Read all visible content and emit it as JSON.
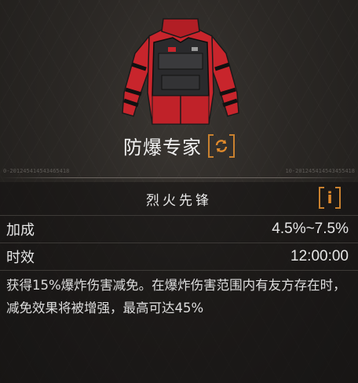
{
  "item": {
    "name": "防爆专家",
    "image_icon": "red-black-armored-jacket",
    "switch_icon": "refresh-cycle-icon",
    "serial_left": "0-201245414543465418",
    "serial_right": "10-201245414543455418"
  },
  "skill": {
    "name": "烈火先锋",
    "info_glyph": "i"
  },
  "stats": [
    {
      "label": "加成",
      "value": "4.5%~7.5%"
    },
    {
      "label": "时效",
      "value": "12:00:00"
    }
  ],
  "description": "获得15%爆炸伤害减免。在爆炸伤害范围内有友方存在时，减免效果将被增强，最高可达45%",
  "colors": {
    "accent": "#c9812f",
    "jacket_red": "#c8252c",
    "armor_black": "#2a2a2c"
  }
}
